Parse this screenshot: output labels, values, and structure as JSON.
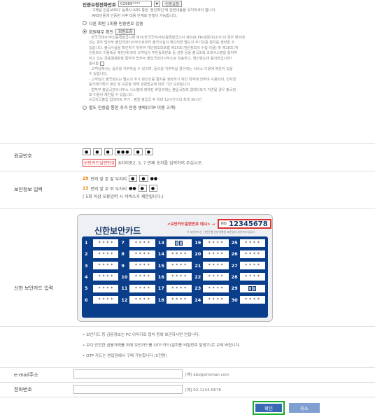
{
  "auth": {
    "label": "인증요청전화번호",
    "phone_value": "02989****",
    "dropdown_icon": "chevron-down-icon",
    "request_button": "인증요청",
    "notes": [
      "· '2채널 인증(ARS)' 등록시 ARS 통한 '본인확인'에 관련내용을 유지하셔야 합니다.",
      "· ARS인증에 인증된 이후 대용 단계로 진행이 가능합니다."
    ]
  },
  "option_other_phone": "다른 확인 1회용 인증번호 입증",
  "option_member": {
    "label": "회원재무 확인",
    "button": "회원조회"
  },
  "long_text": [
    "· 한국국제사(주민등록발급시제 재외(한국국적)주민등록발급소자 제외(R,PR(영문대)조사)의 경우 해외에",
    "있는 경우 법무부 출입국관리사무소로부터 출국사실이 확인되면 별도의 추가인증 절차를 생략할 수",
    "있습니다. 출국사실을 확인하기 위하여 개인정보보호법 제15조(개인정보의 수집·이용) 및 제18조(개",
    "인정보의 이용제공 제한)에 따라 고객님의 주민등록번호 등 성명 등을 출국조회 조회서스템을 통하여",
    "하고 있는 금융결제원을 통하여 법무부 출입국관리사무소로 전송하고, 확인받는데 동의하십니까?",
    "동의함",
    "- 고객님께서는 동의를 거부하실 수 있으며, 동의를 거부하실 경우에는 서비스 이용에 제한이 있을",
    "수 있습니다.",
    "- 고객님의 출국정보는 별도의 추가 본인인증 절차를 생략하기 위한 목적에 한하여 사용되며, 전자금",
    "융거래기록의 생성 및 보존을 위해 관련법규에 따른 기간 보관됩니다.",
    "- 법무부 출입국관리사무소 시스템에 정해진 휴일외에는 출입국정보 업데이트가 지연될 경우 출국정",
    "보 이용이 제한될 수 있습니다.",
    "※국외국출입 업데이트 주기 : 평일 출입국 후 최대 12시간이내 최대 36시간"
  ],
  "option_otp": "별도 인증을 통한 추가 인증 생략(OTP 이용 고객)",
  "account": {
    "label": "원금번호",
    "boxes": [
      "●",
      "●",
      "●",
      "●●●",
      "●",
      "●"
    ],
    "hint_highlight": "보안카드일련번호",
    "hint_text": "8자리중2, 3, 7 번째 숫자를 입력하여 주십시오."
  },
  "security": {
    "label": "보안정보 입력",
    "row1_num": "29",
    "row1_text": "번의 앞 호 앞 두자리",
    "row1_boxes": [
      "●",
      "●"
    ],
    "row1_mask": "●●",
    "row2_num": "13",
    "row2_text": "번의 앞 호 뒤 두자리",
    "row2_mask": "●●",
    "row2_boxes": [
      "●",
      "●"
    ],
    "warning": "( 5회 이상 오류입력 시 서비스가 제한됩니다.)"
  },
  "card": {
    "label": "신한 보안카드 입력",
    "title": "신한보안카드",
    "sample_label": "<보안카드일련번호 예시> →",
    "sample_desc": "이 보안카드는 신한은행 인터넷뱅킹 표준양식 보안카드입니다.",
    "no_label": "NO.",
    "no_value": "12345678",
    "mask": "* * * *",
    "cells": [
      1,
      7,
      13,
      19,
      25,
      2,
      8,
      14,
      20,
      26,
      3,
      9,
      15,
      21,
      27,
      4,
      10,
      16,
      22,
      28,
      5,
      11,
      17,
      23,
      29,
      6,
      12,
      18,
      24,
      30
    ],
    "marked": [
      13,
      29
    ]
  },
  "bullets": [
    "• 보안카드 등 금융정보는 PC 이미지로 캡처 등에 보관하시면 안됩니다.",
    "• 보다 안전한 금융거래를 위해 보안카드를 OTP 카드(일회용 비밀번호 발생기)로 교체 바랍니다.",
    "• OTP 카드는 영업점에서 구매 가능합니다 (5천원)"
  ],
  "email": {
    "label": "e-mail주소",
    "hint": "[예] abs@shinhan.com"
  },
  "phone": {
    "label": "전화번호",
    "hint": "[예] 02-1234-5678"
  },
  "buttons": {
    "ok": "확인",
    "cancel": "취소"
  }
}
